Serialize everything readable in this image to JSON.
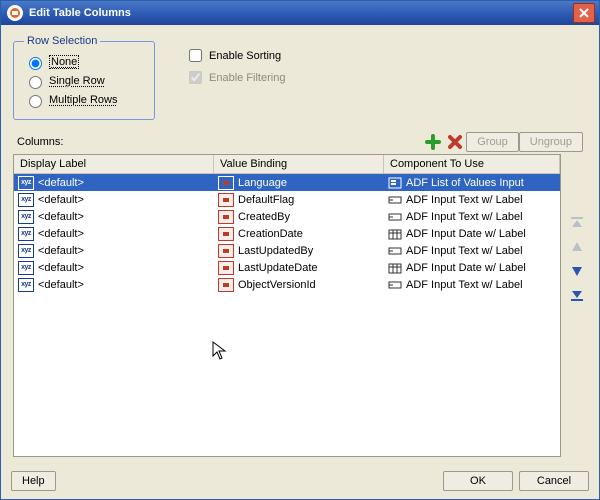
{
  "window": {
    "title": "Edit Table Columns"
  },
  "row_selection": {
    "legend": "Row Selection",
    "options": [
      "None",
      "Single Row",
      "Multiple Rows"
    ],
    "selected": 0
  },
  "checks": {
    "enable_sorting": {
      "label": "Enable Sorting",
      "checked": false,
      "disabled": false
    },
    "enable_filtering": {
      "label": "Enable Filtering",
      "checked": true,
      "disabled": true
    }
  },
  "columns_label": "Columns:",
  "toolbar": {
    "group": "Group",
    "ungroup": "Ungroup"
  },
  "headers": {
    "display_label": "Display Label",
    "value_binding": "Value Binding",
    "component": "Component To Use"
  },
  "rows": [
    {
      "label": "<default>",
      "binding": "Language",
      "component": "ADF List of Values Input",
      "comp_kind": "lov",
      "selected": true
    },
    {
      "label": "<default>",
      "binding": "DefaultFlag",
      "component": "ADF Input Text w/ Label",
      "comp_kind": "text",
      "selected": false
    },
    {
      "label": "<default>",
      "binding": "CreatedBy",
      "component": "ADF Input Text w/ Label",
      "comp_kind": "text",
      "selected": false
    },
    {
      "label": "<default>",
      "binding": "CreationDate",
      "component": "ADF Input Date w/ Label",
      "comp_kind": "date",
      "selected": false
    },
    {
      "label": "<default>",
      "binding": "LastUpdatedBy",
      "component": "ADF Input Text w/ Label",
      "comp_kind": "text",
      "selected": false
    },
    {
      "label": "<default>",
      "binding": "LastUpdateDate",
      "component": "ADF Input Date w/ Label",
      "comp_kind": "date",
      "selected": false
    },
    {
      "label": "<default>",
      "binding": "ObjectVersionId",
      "component": "ADF Input Text w/ Label",
      "comp_kind": "text",
      "selected": false
    }
  ],
  "footer": {
    "help": "Help",
    "ok": "OK",
    "cancel": "Cancel"
  }
}
